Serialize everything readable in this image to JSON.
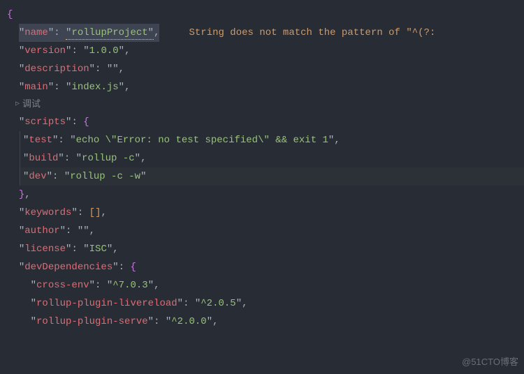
{
  "braces": {
    "open": "{",
    "close": "}",
    "openBracket": "[",
    "closeBracket": "]"
  },
  "quote": "\"",
  "colon": ": ",
  "comma": ",",
  "warning_message": "String does not match the pattern of \"^(?:",
  "debug_label": "调试",
  "json": {
    "name_key": "name",
    "name_val": "rollupProject",
    "version_key": "version",
    "version_val": "1.0.0",
    "description_key": "description",
    "description_val": "",
    "main_key": "main",
    "main_val": "index.js",
    "scripts_key": "scripts",
    "scripts": {
      "test_key": "test",
      "test_val": "echo \\\"Error: no test specified\\\" && exit 1",
      "build_key": "build",
      "build_val": "rollup -c",
      "dev_key": "dev",
      "dev_val": "rollup -c -w"
    },
    "keywords_key": "keywords",
    "author_key": "author",
    "author_val": "",
    "license_key": "license",
    "license_val": "ISC",
    "devDependencies_key": "devDependencies",
    "devDeps": {
      "crossenv_key": "cross-env",
      "crossenv_val": "^7.0.3",
      "livereload_key": "rollup-plugin-livereload",
      "livereload_val": "^2.0.5",
      "serve_key": "rollup-plugin-serve",
      "serve_val": "^2.0.0"
    }
  },
  "watermark": "@51CTO博客"
}
